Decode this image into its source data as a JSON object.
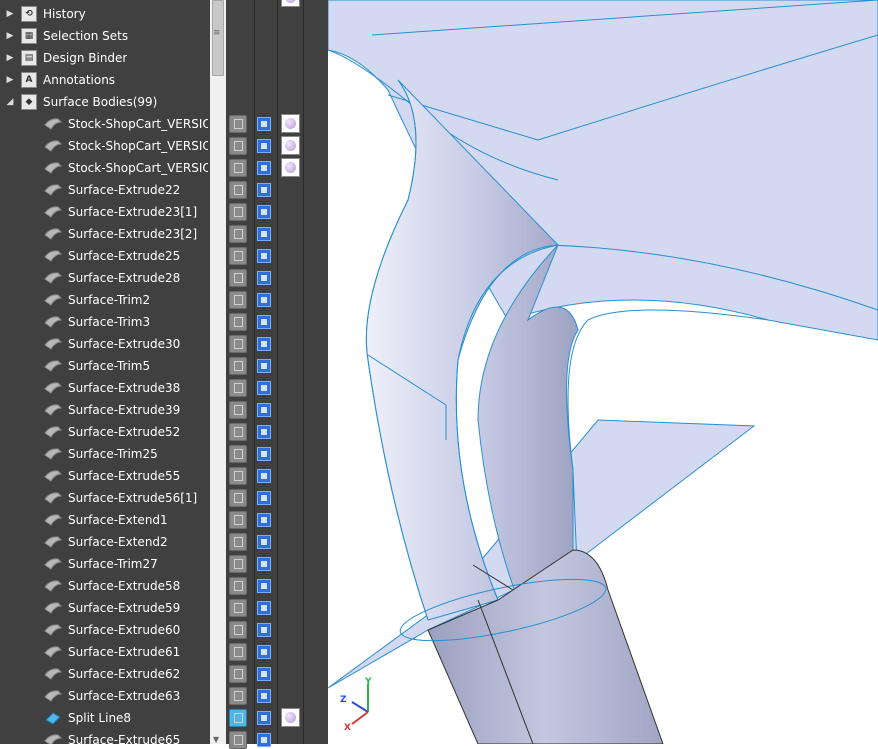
{
  "tree": {
    "top_items": [
      {
        "label": "History",
        "icon": "history-icon"
      },
      {
        "label": "Selection Sets",
        "icon": "selection-sets-icon"
      },
      {
        "label": "Design Binder",
        "icon": "design-binder-icon"
      },
      {
        "label": "Annotations",
        "icon": "annotations-icon"
      },
      {
        "label": "Surface Bodies(99)",
        "icon": "surface-bodies-folder-icon"
      }
    ],
    "bodies": [
      {
        "label": "Stock-ShopCart_VERSION_",
        "appearance": true
      },
      {
        "label": "Stock-ShopCart_VERSION_",
        "appearance": true
      },
      {
        "label": "Stock-ShopCart_VERSION_",
        "appearance": true
      },
      {
        "label": "Surface-Extrude22"
      },
      {
        "label": "Surface-Extrude23[1]"
      },
      {
        "label": "Surface-Extrude23[2]"
      },
      {
        "label": "Surface-Extrude25"
      },
      {
        "label": "Surface-Extrude28"
      },
      {
        "label": "Surface-Trim2"
      },
      {
        "label": "Surface-Trim3"
      },
      {
        "label": "Surface-Extrude30"
      },
      {
        "label": "Surface-Trim5"
      },
      {
        "label": "Surface-Extrude38"
      },
      {
        "label": "Surface-Extrude39"
      },
      {
        "label": "Surface-Extrude52"
      },
      {
        "label": "Surface-Trim25"
      },
      {
        "label": "Surface-Extrude55"
      },
      {
        "label": "Surface-Extrude56[1]"
      },
      {
        "label": "Surface-Extend1"
      },
      {
        "label": "Surface-Extend2"
      },
      {
        "label": "Surface-Trim27"
      },
      {
        "label": "Surface-Extrude58"
      },
      {
        "label": "Surface-Extrude59"
      },
      {
        "label": "Surface-Extrude60"
      },
      {
        "label": "Surface-Extrude61"
      },
      {
        "label": "Surface-Extrude62"
      },
      {
        "label": "Surface-Extrude63"
      },
      {
        "label": "Split Line8",
        "solid": true,
        "appearance": true
      },
      {
        "label": "Surface-Extrude65"
      }
    ]
  },
  "triad": {
    "x_label": "X",
    "y_label": "Y",
    "z_label": "Z"
  },
  "colors": {
    "panel_bg": "#404040",
    "surface_fill": "#d4d9f2",
    "edge_line": "#2a8fd0",
    "tube_dark": "#a9aecb"
  }
}
